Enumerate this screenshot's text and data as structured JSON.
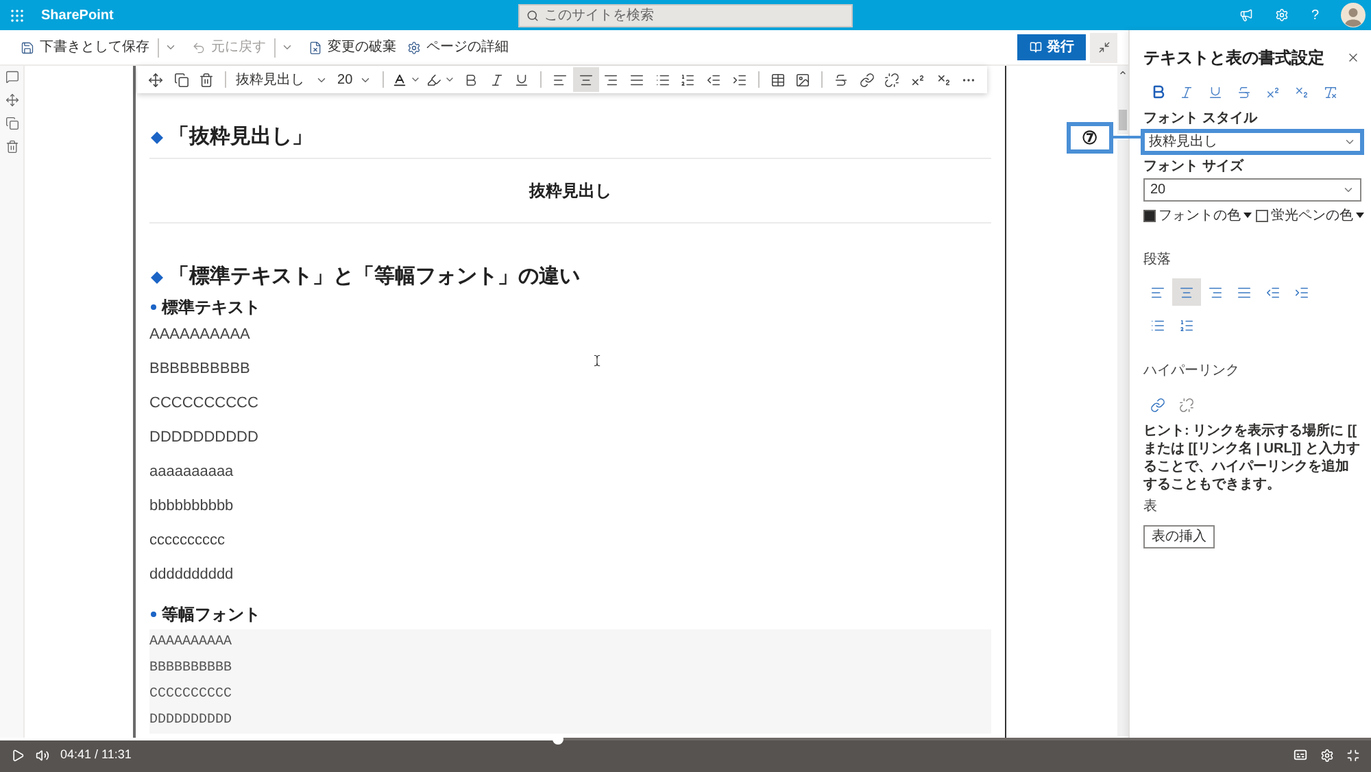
{
  "suite_bar": {
    "app_name": "SharePoint",
    "search": {
      "placeholder": "このサイトを検索"
    },
    "help": "?"
  },
  "command_bar": {
    "items": [
      {
        "kind": "save",
        "label": "下書きとして保存",
        "disabled": false,
        "has_menu": true
      },
      {
        "kind": "undo",
        "label": "元に戻す",
        "disabled": true,
        "has_menu": true
      },
      {
        "kind": "discard",
        "label": "変更の破棄",
        "disabled": false
      },
      {
        "kind": "details",
        "label": "ページの詳細",
        "disabled": false
      }
    ],
    "publish": "発行"
  },
  "editor_toolbar": {
    "font_style": "抜粋見出し",
    "font_size": "20",
    "paragraph_buttons": [
      {
        "kind": "align_left",
        "selected": false
      },
      {
        "kind": "align_center",
        "selected": true
      },
      {
        "kind": "align_right",
        "selected": false
      },
      {
        "kind": "justify",
        "selected": false
      },
      {
        "kind": "bullets",
        "selected": false
      },
      {
        "kind": "numbering",
        "selected": false
      },
      {
        "kind": "outdent",
        "selected": false
      },
      {
        "kind": "indent",
        "selected": false
      }
    ]
  },
  "page": {
    "blocks": [
      {
        "kind": "heading",
        "text": "「抜粋見出し」"
      },
      {
        "kind": "pull_quote",
        "text": "抜粋見出し"
      },
      {
        "kind": "heading",
        "text": "「標準テキスト」と「等幅フォント」の違い"
      },
      {
        "kind": "subheading",
        "text": "標準テキスト"
      },
      {
        "kind": "paragraph",
        "text": "AAAAAAAAAA"
      },
      {
        "kind": "paragraph",
        "text": "BBBBBBBBBB"
      },
      {
        "kind": "paragraph",
        "text": "CCCCCCCCCC"
      },
      {
        "kind": "paragraph",
        "text": "DDDDDDDDDD"
      },
      {
        "kind": "paragraph",
        "text": "aaaaaaaaaa"
      },
      {
        "kind": "paragraph",
        "text": "bbbbbbbbbb"
      },
      {
        "kind": "paragraph",
        "text": "cccccccccc"
      },
      {
        "kind": "paragraph",
        "text": "dddddddddd"
      },
      {
        "kind": "subheading",
        "text": "等幅フォント"
      },
      {
        "kind": "code",
        "lines": [
          "AAAAAAAAAA",
          "BBBBBBBBBB",
          "CCCCCCCCCC",
          "DDDDDDDDDD"
        ]
      }
    ]
  },
  "format_pane": {
    "title": "テキストと表の書式設定",
    "font_style": {
      "label": "フォント スタイル",
      "value": "抜粋見出し",
      "highlighted": true
    },
    "font_size": {
      "label": "フォント サイズ",
      "value": "20"
    },
    "colors": [
      {
        "label": "フォントの色",
        "color": "#262626"
      },
      {
        "label": "蛍光ペンの色",
        "color": "#ffffff"
      }
    ],
    "paragraph": {
      "label": "段落",
      "buttons": [
        {
          "kind": "align_left",
          "selected": false
        },
        {
          "kind": "align_center",
          "selected": true
        },
        {
          "kind": "align_right",
          "selected": false
        },
        {
          "kind": "justify",
          "selected": false
        },
        {
          "kind": "outdent",
          "selected": false
        },
        {
          "kind": "indent",
          "selected": false
        },
        {
          "kind": "bullets",
          "selected": false
        },
        {
          "kind": "numbering",
          "selected": false
        }
      ]
    },
    "hyperlink": {
      "label": "ハイパーリンク",
      "hint": "ヒント: リンクを表示する場所に [[ または [[リンク名 | URL]] と入力することで、ハイパーリンクを追加することもできます。"
    },
    "table": {
      "label": "表",
      "button": "表の挿入"
    }
  },
  "annotation": {
    "label": "⑦"
  },
  "video_player": {
    "time": "04:41 / 11:31",
    "level": 0.407
  }
}
